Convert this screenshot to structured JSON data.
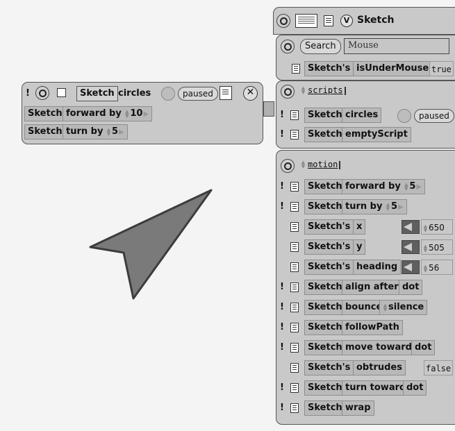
{
  "colors": {
    "panel_bg": "#c9c9c9",
    "tile_bg": "#b9b9b9",
    "arrow_fill": "#7a7a7a",
    "canvas_bg": "#f4f4f4"
  },
  "script_tile": {
    "bang": "!",
    "object_name": "Sketch",
    "script_name": "circles",
    "status": "paused",
    "lines": [
      {
        "object": "Sketch",
        "command": "forward by",
        "value": "10"
      },
      {
        "object": "Sketch",
        "command": "turn by",
        "value": "5"
      }
    ]
  },
  "viewer": {
    "header": {
      "menu_glyph": "V",
      "title": "Sketch"
    },
    "search": {
      "button": "Search",
      "value": "Mouse"
    },
    "search_result": {
      "object": "Sketch's",
      "slot": "isUnderMouse",
      "value": "true"
    },
    "scripts_category": {
      "title": "scripts",
      "rows": [
        {
          "bang": "!",
          "object": "Sketch",
          "command": "circles",
          "status": "paused"
        },
        {
          "bang": "!",
          "object": "Sketch",
          "command": "emptyScript"
        }
      ]
    },
    "motion_category": {
      "title": "motion",
      "rows": [
        {
          "bang": "!",
          "object": "Sketch",
          "command": "forward by",
          "arg": "5"
        },
        {
          "bang": "!",
          "object": "Sketch",
          "command": "turn by",
          "arg": "5"
        },
        {
          "bang": "",
          "object": "Sketch's",
          "slot": "x",
          "value": "650"
        },
        {
          "bang": "",
          "object": "Sketch's",
          "slot": "y",
          "value": "505"
        },
        {
          "bang": "",
          "object": "Sketch's",
          "slot": "heading",
          "value": "56"
        },
        {
          "bang": "!",
          "object": "Sketch",
          "command": "align after",
          "arg": "dot"
        },
        {
          "bang": "!",
          "object": "Sketch",
          "command": "bounce",
          "arg": "silence"
        },
        {
          "bang": "!",
          "object": "Sketch",
          "command": "followPath"
        },
        {
          "bang": "!",
          "object": "Sketch",
          "command": "move toward",
          "arg": "dot"
        },
        {
          "bang": "",
          "object": "Sketch's",
          "slot": "obtrudes",
          "value": "false"
        },
        {
          "bang": "!",
          "object": "Sketch",
          "command": "turn toward",
          "arg": "dot"
        },
        {
          "bang": "!",
          "object": "Sketch",
          "command": "wrap"
        }
      ]
    }
  }
}
